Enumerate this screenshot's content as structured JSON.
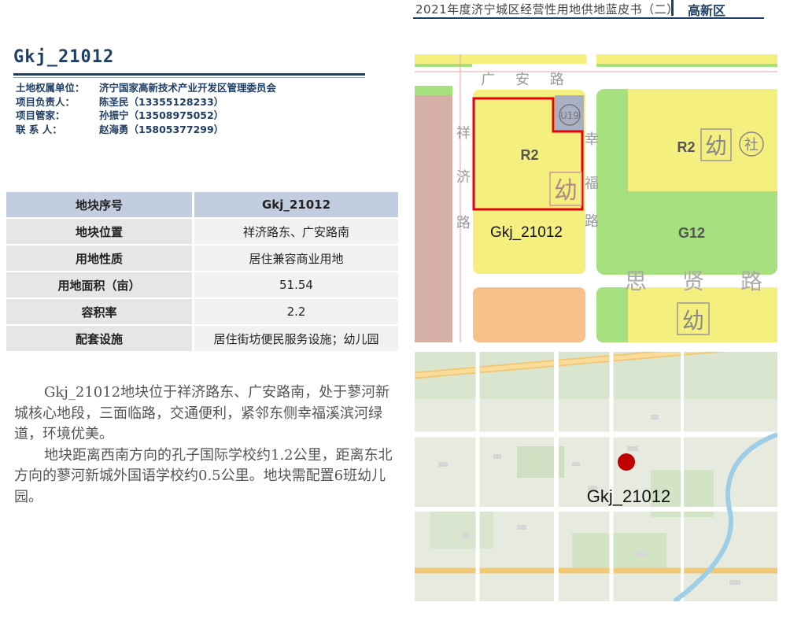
{
  "header": {
    "title": "2021年度济宁城区经营性用地供地蓝皮书（二）",
    "region": "高新区"
  },
  "parcel_code": "Gkj_21012",
  "contact": [
    {
      "label": "土地权属单位：",
      "value": "济宁国家高新技术产业开发区管理委员会"
    },
    {
      "label": "项目负责人：",
      "value": "陈圣民（13355128233）"
    },
    {
      "label": "项目管家：",
      "value": "孙振宁（13508975052）"
    },
    {
      "label": "联 系 人：",
      "value": "赵海勇（15805377299）"
    }
  ],
  "table": {
    "header": {
      "label": "地块序号",
      "value": "Gkj_21012"
    },
    "rows": [
      {
        "label": "地块位置",
        "value": "祥济路东、广安路南"
      },
      {
        "label": "用地性质",
        "value": "居住兼容商业用地"
      },
      {
        "label": "用地面积（亩）",
        "value": "51.54"
      },
      {
        "label": "容积率",
        "value": "2.2"
      },
      {
        "label": "配套设施",
        "value": "居住街坊便民服务设施；幼儿园"
      }
    ]
  },
  "description": [
    "Gkj_21012地块位于祥济路东、广安路南，处于蓼河新城核心地段，三面临路，交通便利，紧邻东侧幸福溪滨河绿道，环境优美。",
    "地块距离西南方向的孔子国际学校约1.2公里，距离东北方向的蓼河新城外国语学校约0.5公里。地块需配置6班幼儿园。"
  ],
  "plan_map": {
    "road_guangan": "广 安 路",
    "road_xiangji": [
      "祥",
      "济",
      "路"
    ],
    "road_xingfu": [
      "幸",
      "福",
      "路"
    ],
    "road_sixian": [
      "思",
      "贤",
      "路"
    ],
    "parcel_code_label": "Gkj_21012",
    "r2_left": "R2",
    "r2_right": "R2",
    "g12": "G12",
    "u19": "U19",
    "kindergarten": "幼",
    "community": "社"
  },
  "location_map": {
    "parcel_code_label": "Gkj_21012",
    "marker_color": "#c00000"
  }
}
